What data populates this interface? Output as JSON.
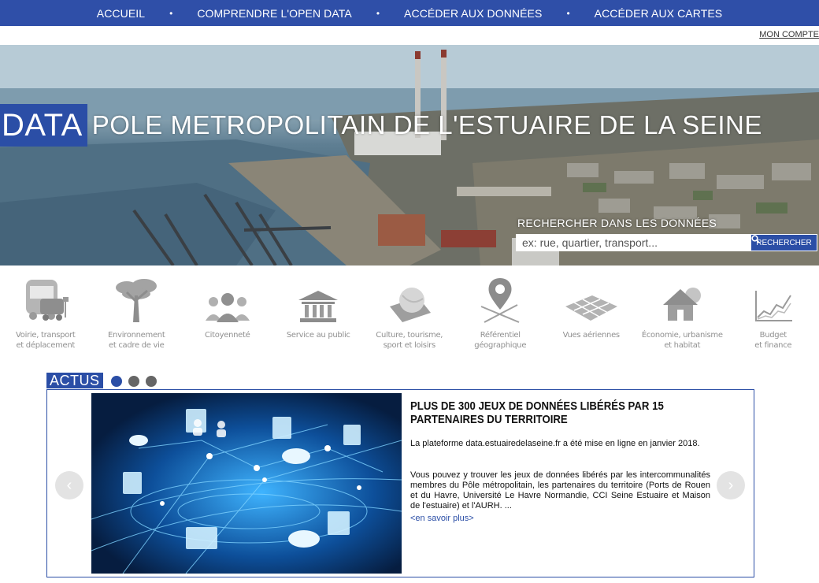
{
  "nav": {
    "items": [
      "ACCUEIL",
      "COMPRENDRE L'OPEN DATA",
      "ACCÉDER AUX DONNÉES",
      "ACCÉDER AUX CARTES"
    ],
    "separator": "•",
    "account": "MON COMPTE"
  },
  "hero": {
    "title_box": "DATA",
    "title_rest": "POLE METROPOLITAIN DE L'ESTUAIRE DE LA SEINE",
    "search_label": "RECHERCHER DANS LES DONNÉES",
    "search_placeholder": "ex: rue, quartier, transport...",
    "search_button": "RECHERCHER"
  },
  "categories": [
    {
      "label": "Voirie, transport\net déplacement",
      "icon": "bus-icon"
    },
    {
      "label": "Environnement\net cadre de vie",
      "icon": "tree-icon"
    },
    {
      "label": "Citoyenneté",
      "icon": "people-icon"
    },
    {
      "label": "Service au public",
      "icon": "building-icon"
    },
    {
      "label": "Culture, tourisme,\nsport et loisirs",
      "icon": "ball-icon"
    },
    {
      "label": "Référentiel\ngéographique",
      "icon": "map-pin-icon"
    },
    {
      "label": "Vues aériennes",
      "icon": "aerial-grid-icon"
    },
    {
      "label": "Économie, urbanisme\net habitat",
      "icon": "house-icon"
    },
    {
      "label": "Budget\net finance",
      "icon": "chart-icon"
    }
  ],
  "actus": {
    "tab": "ACTUS",
    "title": "PLUS DE 300 JEUX DE DONNÉES LIBÉRÉS PAR 15 PARTENAIRES DU TERRITOIRE",
    "p1": "La plateforme data.estuairedelaseine.fr a été mise en ligne en janvier 2018.",
    "p2": "Vous pouvez y trouver les jeux de données libérés par les intercommunalités membres du Pôle métropolitain, les partenaires du territoire (Ports de Rouen et du Havre, Université Le Havre Normandie, CCI Seine Estuaire et Maison de l'estuaire) et l'AURH. ...",
    "more": "<en savoir plus>",
    "prev": "‹",
    "next": "›"
  },
  "colors": {
    "brand_blue": "#2b4ea6",
    "nav_blue": "#2f4fa8",
    "icon_grey": "#9a9a9a"
  }
}
